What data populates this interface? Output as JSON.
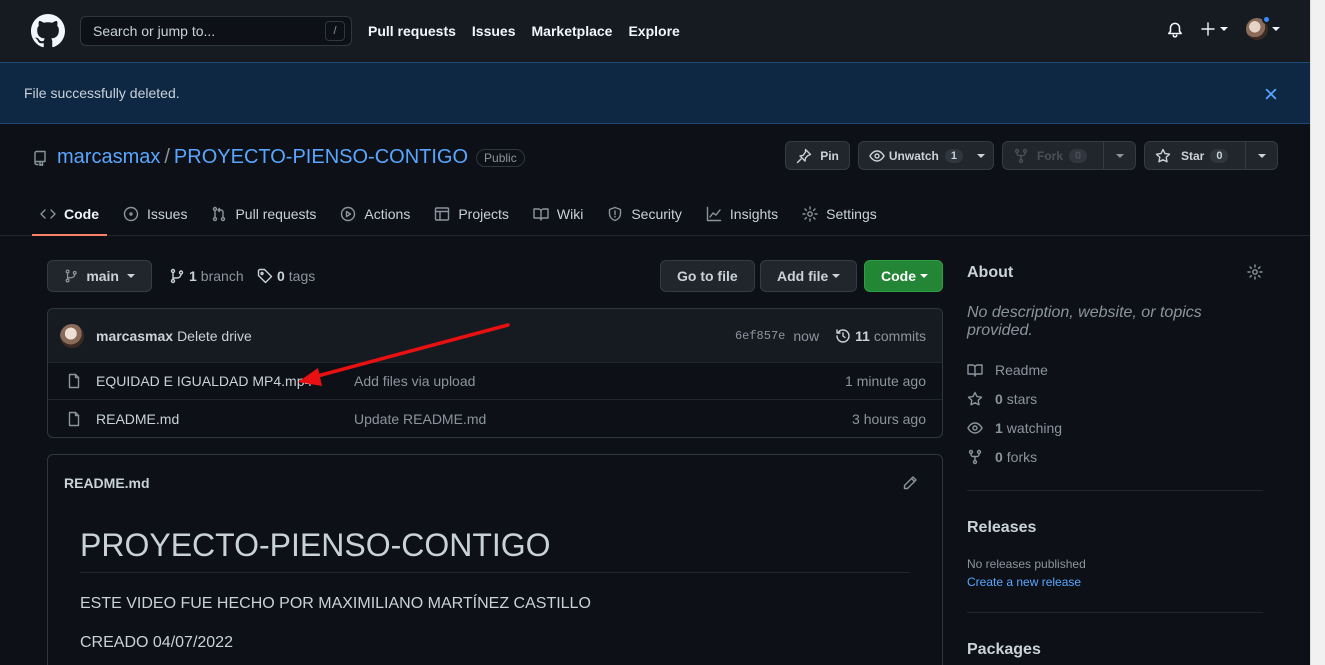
{
  "header": {
    "search_placeholder": "Search or jump to...",
    "search_shortcut": "/",
    "nav": [
      "Pull requests",
      "Issues",
      "Marketplace",
      "Explore"
    ]
  },
  "flash": {
    "message": "File successfully deleted."
  },
  "repo": {
    "owner": "marcasmax",
    "separator": "/",
    "name": "PROYECTO-PIENSO-CONTIGO",
    "visibility": "Public",
    "pin_label": "Pin",
    "unwatch_label": "Unwatch",
    "watch_count": "1",
    "fork_label": "Fork",
    "fork_count": "0",
    "star_label": "Star",
    "star_count": "0"
  },
  "tabs": [
    {
      "label": "Code",
      "icon": "code-icon"
    },
    {
      "label": "Issues",
      "icon": "issue-icon"
    },
    {
      "label": "Pull requests",
      "icon": "pull-request-icon"
    },
    {
      "label": "Actions",
      "icon": "play-icon"
    },
    {
      "label": "Projects",
      "icon": "table-icon"
    },
    {
      "label": "Wiki",
      "icon": "book-icon"
    },
    {
      "label": "Security",
      "icon": "shield-icon"
    },
    {
      "label": "Insights",
      "icon": "graph-icon"
    },
    {
      "label": "Settings",
      "icon": "gear-icon"
    }
  ],
  "toolbar": {
    "branch": "main",
    "branch_count": "1",
    "branch_word": "branch",
    "tag_count": "0",
    "tag_word": "tags",
    "go_to_file": "Go to file",
    "add_file": "Add file",
    "code": "Code"
  },
  "commit": {
    "author": "marcasmax",
    "message": "Delete drive",
    "sha": "6ef857e",
    "when": "now",
    "count": "11",
    "count_word": "commits"
  },
  "files": [
    {
      "name": "EQUIDAD E IGUALDAD MP4.mp4",
      "message": "Add files via upload",
      "age": "1 minute ago"
    },
    {
      "name": "README.md",
      "message": "Update README.md",
      "age": "3 hours ago"
    }
  ],
  "readme": {
    "filename": "README.md",
    "heading": "PROYECTO-PIENSO-CONTIGO",
    "line1": "ESTE VIDEO FUE HECHO POR MAXIMILIANO MARTÍNEZ CASTILLO",
    "line2": "CREADO 04/07/2022"
  },
  "about": {
    "title": "About",
    "description": "No description, website, or topics provided.",
    "readme_label": "Readme",
    "stars_count": "0",
    "stars_word": "stars",
    "watching_count": "1",
    "watching_word": "watching",
    "forks_count": "0",
    "forks_word": "forks"
  },
  "releases": {
    "title": "Releases",
    "none": "No releases published",
    "create": "Create a new release"
  },
  "packages": {
    "title": "Packages"
  },
  "colors": {
    "accent": "#58a6ff",
    "green": "#238636",
    "annotation_arrow": "#e81010",
    "tab_underline": "#f78166"
  }
}
